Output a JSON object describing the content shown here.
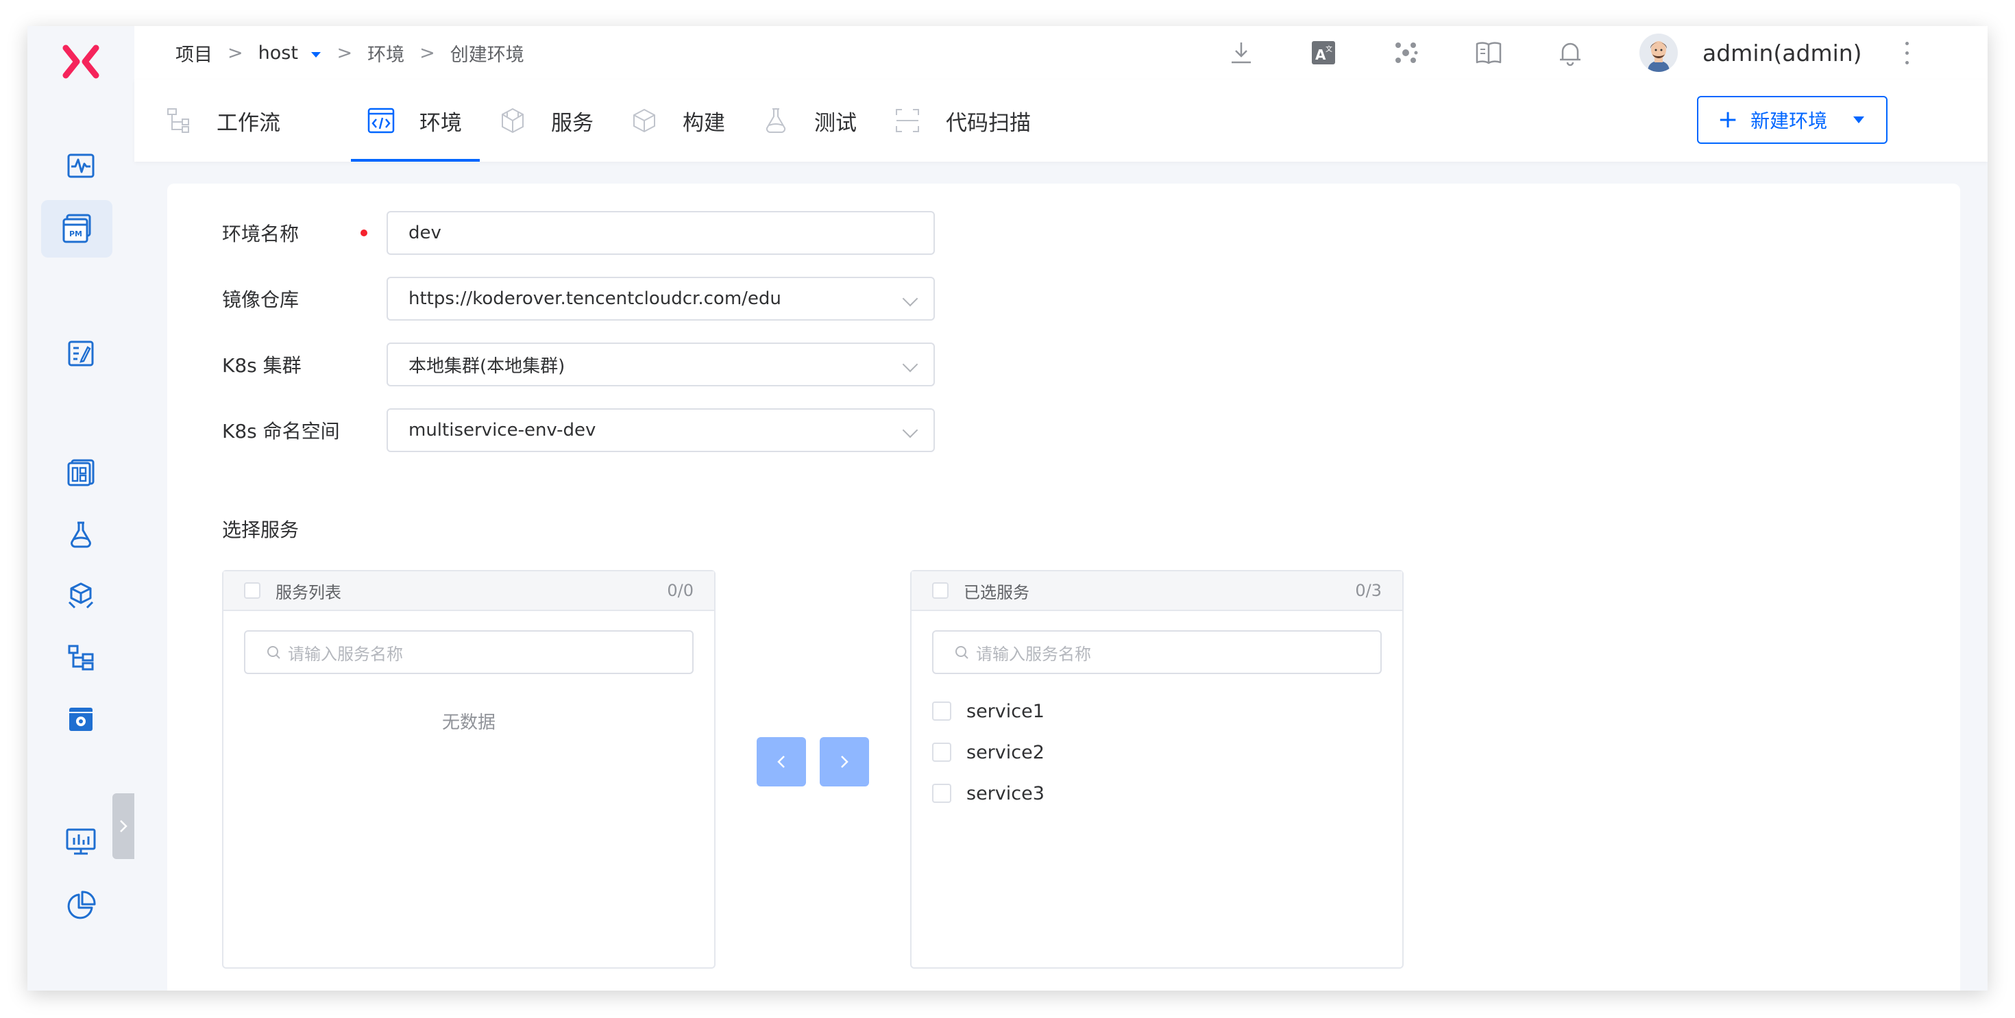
{
  "app": {
    "logo": "koderover-x-logo"
  },
  "rail": {
    "items": [
      {
        "name": "activity-icon"
      },
      {
        "name": "pm-icon",
        "label": "PM",
        "active": true
      },
      {
        "name": "edit-doc-icon"
      },
      {
        "name": "dashboard-icon"
      },
      {
        "name": "flask-icon"
      },
      {
        "name": "package-icon"
      },
      {
        "name": "flow-icon"
      },
      {
        "name": "settings-box-icon"
      },
      {
        "name": "monitor-icon"
      },
      {
        "name": "pie-chart-icon"
      }
    ]
  },
  "breadcrumb": {
    "root": "项目",
    "sep": ">",
    "project": "host",
    "env": "环境",
    "current": "创建环境"
  },
  "header": {
    "icons": [
      "download-icon",
      "translate-icon",
      "cluster-icon",
      "book-icon",
      "bell-icon"
    ],
    "user": "admin(admin)"
  },
  "tabs": [
    {
      "label": "工作流",
      "icon": "workflow-icon",
      "active": false
    },
    {
      "label": "环境",
      "icon": "code-icon",
      "active": true
    },
    {
      "label": "服务",
      "icon": "service-icon",
      "active": false
    },
    {
      "label": "构建",
      "icon": "build-icon",
      "active": false
    },
    {
      "label": "测试",
      "icon": "test-icon",
      "active": false
    },
    {
      "label": "代码扫描",
      "icon": "scan-icon",
      "active": false
    }
  ],
  "actions": {
    "new_env": "新建环境"
  },
  "form": {
    "env_name": {
      "label": "环境名称",
      "value": "dev",
      "required": true
    },
    "registry": {
      "label": "镜像仓库",
      "value": "https://koderover.tencentcloudcr.com/edu"
    },
    "cluster": {
      "label": "K8s 集群",
      "value": "本地集群(本地集群)"
    },
    "namespace": {
      "label": "K8s 命名空间",
      "value": "multiservice-env-dev"
    },
    "select_services": "选择服务"
  },
  "transfer": {
    "left": {
      "title": "服务列表",
      "count": "0/0",
      "placeholder": "请输入服务名称",
      "empty": "无数据"
    },
    "right": {
      "title": "已选服务",
      "count": "0/3",
      "placeholder": "请输入服务名称",
      "items": [
        "service1",
        "service2",
        "service3"
      ]
    }
  },
  "colors": {
    "accent": "#0066ff",
    "logo": "#f5245b",
    "icon": "#1f6fd1",
    "disabled_btn": "#8fb7ff"
  }
}
